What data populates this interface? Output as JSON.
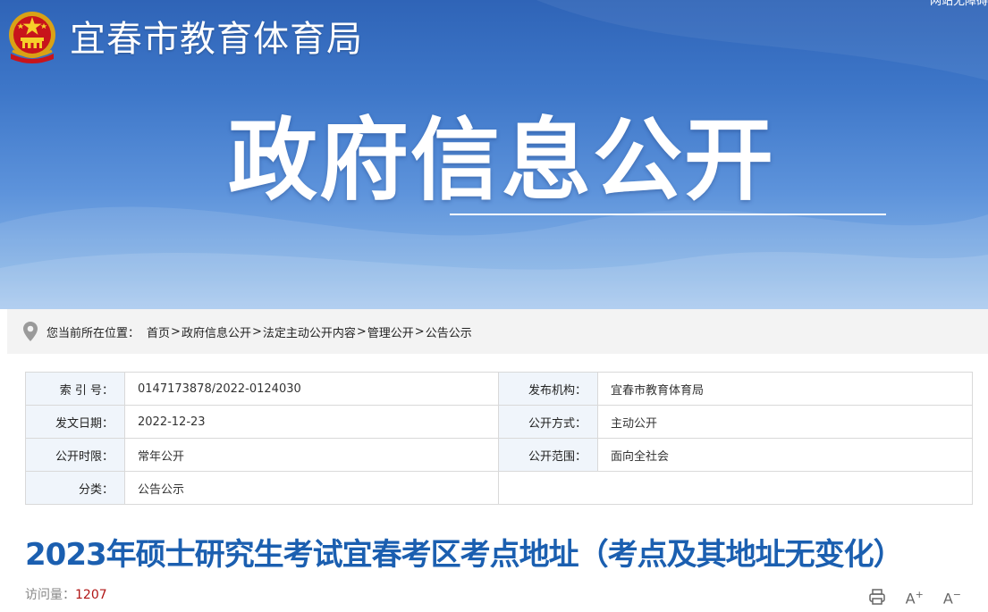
{
  "header": {
    "site_name": "宜春市教育体育局",
    "accessibility_link": "网站无障碍",
    "hero_title": "政府信息公开"
  },
  "breadcrumb": {
    "label": "您当前所在位置：",
    "items": [
      "首页",
      "政府信息公开",
      "法定主动公开内容",
      "管理公开",
      "公告公示"
    ],
    "separator": ">"
  },
  "meta": {
    "index_no_label": "索 引 号：",
    "index_no": "0147173878/2022-0124030",
    "publisher_label": "发布机构：",
    "publisher": "宜春市教育体育局",
    "date_label": "发文日期：",
    "date": "2022-12-23",
    "method_label": "公开方式：",
    "method": "主动公开",
    "period_label": "公开时限：",
    "period": "常年公开",
    "scope_label": "公开范围：",
    "scope": "面向全社会",
    "category_label": "分类：",
    "category": "公告公示"
  },
  "article": {
    "title": "2023年硕士研究生考试宜春考区考点地址（考点及其地址无变化）",
    "visits_label": "访问量：",
    "visits": "1207"
  },
  "colors": {
    "title_blue": "#1b5fb0",
    "visit_red": "#b01515",
    "table_header_bg": "#f0f5fb"
  },
  "icons": [
    "national-emblem-icon",
    "location-pin-icon",
    "print-icon",
    "font-increase-icon",
    "font-decrease-icon"
  ]
}
